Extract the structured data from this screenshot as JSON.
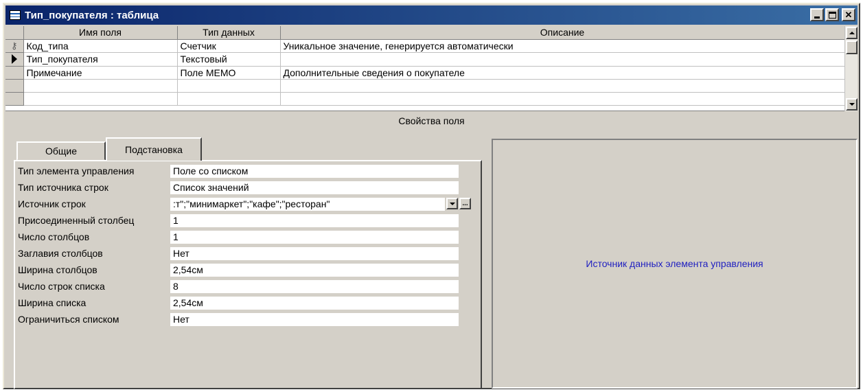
{
  "window": {
    "title": "Тип_покупателя : таблица",
    "icon": "table-icon"
  },
  "grid": {
    "columns": [
      "Имя поля",
      "Тип данных",
      "Описание"
    ],
    "rows": [
      {
        "indicator": "key-icon",
        "name": "Код_типа",
        "type": "Счетчик",
        "description": "Уникальное значение, генерируется автоматически"
      },
      {
        "indicator": "row-pointer-icon",
        "name": "Тип_покупателя",
        "type": "Текстовый",
        "description": ""
      },
      {
        "indicator": "",
        "name": "Примечание",
        "type": "Поле MEMO",
        "description": "Дополнительные сведения о покупателе"
      },
      {
        "indicator": "",
        "name": "",
        "type": "",
        "description": ""
      },
      {
        "indicator": "",
        "name": "",
        "type": "",
        "description": ""
      }
    ]
  },
  "properties": {
    "header": "Свойства поля",
    "tabs": [
      {
        "label": "Общие",
        "active": false
      },
      {
        "label": "Подстановка",
        "active": true
      }
    ],
    "items": [
      {
        "label": "Тип элемента управления",
        "value": "Поле со списком"
      },
      {
        "label": "Тип источника строк",
        "value": "Список значений"
      },
      {
        "label": "Источник строк",
        "value": ":т\";\"минимаркет\";\"кафе\";\"ресторан\""
      },
      {
        "label": "Присоединенный столбец",
        "value": "1"
      },
      {
        "label": "Число столбцов",
        "value": "1"
      },
      {
        "label": "Заглавия столбцов",
        "value": "Нет"
      },
      {
        "label": "Ширина столбцов",
        "value": "2,54см"
      },
      {
        "label": "Число строк списка",
        "value": "8"
      },
      {
        "label": "Ширина списка",
        "value": "2,54см"
      },
      {
        "label": "Ограничиться списком",
        "value": "Нет"
      }
    ],
    "builder_button": "...",
    "help_text": "Источник данных элемента управления"
  },
  "colors": {
    "title_bar": "#0a246a",
    "face": "#d4d0c8",
    "help_text": "#2020c0"
  }
}
